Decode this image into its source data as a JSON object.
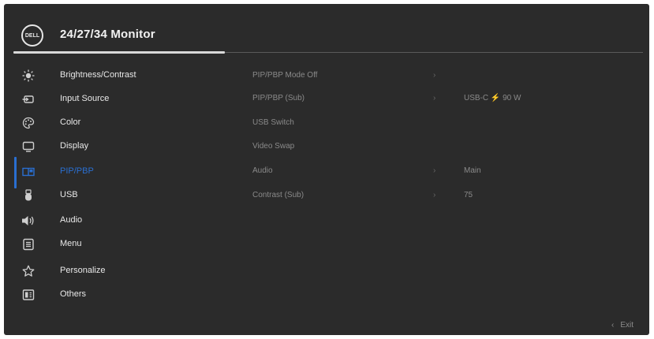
{
  "window": {
    "title": "24/27/34 Monitor",
    "logo_text": "DELL"
  },
  "menu": {
    "items": [
      {
        "label": "Brightness/Contrast",
        "icon": "brightness-icon"
      },
      {
        "label": "Input Source",
        "icon": "input-source-icon"
      },
      {
        "label": "Color",
        "icon": "color-icon"
      },
      {
        "label": "Display",
        "icon": "display-icon"
      },
      {
        "label": "PIP/PBP",
        "icon": "pip-pbp-icon",
        "active": true
      },
      {
        "label": "USB",
        "icon": "usb-icon"
      },
      {
        "label": "Audio",
        "icon": "audio-icon"
      },
      {
        "label": "Menu",
        "icon": "menu-icon"
      },
      {
        "label": "Personalize",
        "icon": "star-icon"
      },
      {
        "label": "Others",
        "icon": "others-icon"
      }
    ]
  },
  "submenu": {
    "rows": [
      {
        "name": "PIP/PBP Mode Off",
        "chevron": "›",
        "value": ""
      },
      {
        "name": "PIP/PBP (Sub)",
        "chevron": "›",
        "value": "USB-C ⚡ 90 W"
      },
      {
        "name": "USB Switch",
        "chevron": "",
        "value": ""
      },
      {
        "name": "Video Swap",
        "chevron": "",
        "value": ""
      },
      {
        "name": "Audio",
        "chevron": "›",
        "value": "Main"
      },
      {
        "name": "Contrast (Sub)",
        "chevron": "›",
        "value": "75"
      }
    ]
  },
  "footer": {
    "exit_arrow": "‹",
    "exit_label": "Exit"
  },
  "colors": {
    "background": "#2b2b2b",
    "accent": "#2a6fd1",
    "text": "#e8e8e8",
    "disabled_text": "#8a8a8a"
  }
}
